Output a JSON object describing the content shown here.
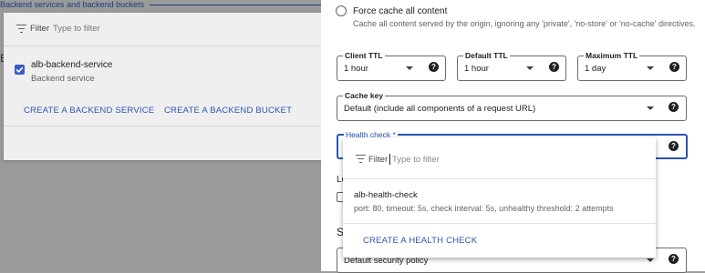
{
  "background": {
    "title": "Backend services and backend buckets",
    "stray_letter": "B",
    "filter": {
      "label": "Filter",
      "placeholder": "Type to filter"
    },
    "service": {
      "name": "alb-backend-service",
      "type": "Backend service",
      "checked": true
    },
    "buttons": {
      "create_service": "CREATE A BACKEND SERVICE",
      "create_bucket": "CREATE A BACKEND BUCKET"
    }
  },
  "panel": {
    "force_cache": {
      "label": "Force cache all content",
      "description": "Cache all content served by the origin, ignoring any 'private', 'no-store' or 'no-cache' directives."
    },
    "client_ttl": {
      "label": "Client TTL",
      "value": "1 hour"
    },
    "default_ttl": {
      "label": "Default TTL",
      "value": "1 hour"
    },
    "max_ttl": {
      "label": "Maximum TTL",
      "value": "1 day"
    },
    "cache_key": {
      "label": "Cache key",
      "value": "Default (include all components of a request URL)"
    },
    "health_check": {
      "label": "Health check *",
      "value": ""
    },
    "partial_labels": {
      "lo": "Lo",
      "s": "S"
    },
    "security_policy": {
      "value": "Default security policy"
    },
    "help_glyph": "?"
  },
  "dropdown": {
    "filter": {
      "label": "Filter",
      "placeholder": "Type to filter"
    },
    "items": [
      {
        "name": "alb-health-check",
        "description": "port: 80, timeout: 5s, check interval: 5s, unhealthy threshold: 2 attempts"
      }
    ],
    "create_label": "CREATE A HEALTH CHECK"
  },
  "colors": {
    "accent": "#2a55b5",
    "overlay": "#9a9a9a"
  }
}
